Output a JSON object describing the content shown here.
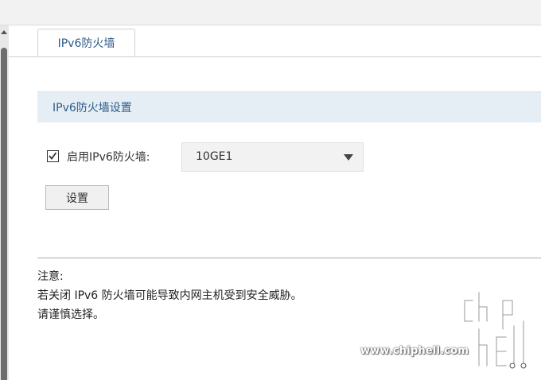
{
  "tabs": [
    {
      "label": "IPv6防火墙",
      "active": true
    }
  ],
  "section": {
    "title": "IPv6防火墙设置"
  },
  "form": {
    "enable_label": "启用IPv6防火墙:",
    "enable_checked": true,
    "interface_value": "10GE1",
    "set_button_label": "设置"
  },
  "notes": {
    "title": "注意:",
    "line1": "若关闭 IPv6 防火墙可能导致内网主机受到安全威胁。",
    "line2": "请谨慎选择。"
  },
  "watermark": {
    "site": "www.chiphell.com",
    "logo": "chiphell-logo"
  },
  "colors": {
    "accent": "#2c5b8a",
    "section_bg": "#e6eef5",
    "select_bg": "#f2f2f2"
  }
}
